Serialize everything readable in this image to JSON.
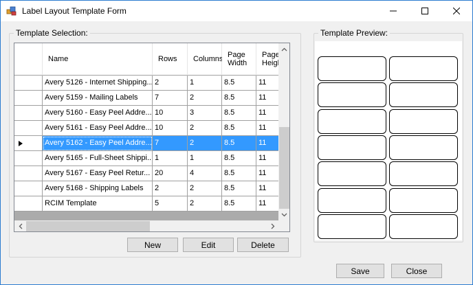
{
  "window": {
    "title": "Label Layout Template Form"
  },
  "template_selection": {
    "label": "Template Selection:",
    "columns": [
      "Name",
      "Rows",
      "Columns",
      "Page\nWidth",
      "Page\nHeigh"
    ],
    "rows": [
      {
        "name": "Avery 5126 - Internet Shipping...",
        "rows": "2",
        "columns": "1",
        "width": "8.5",
        "height": "11"
      },
      {
        "name": "Avery 5159 - Mailing Labels",
        "rows": "7",
        "columns": "2",
        "width": "8.5",
        "height": "11"
      },
      {
        "name": "Avery 5160 - Easy Peel Addre...",
        "rows": "10",
        "columns": "3",
        "width": "8.5",
        "height": "11"
      },
      {
        "name": "Avery 5161 - Easy Peel Addre...",
        "rows": "10",
        "columns": "2",
        "width": "8.5",
        "height": "11"
      },
      {
        "name": "Avery 5162 - Easy Peel Addre...",
        "rows": "7",
        "columns": "2",
        "width": "8.5",
        "height": "11"
      },
      {
        "name": "Avery 5165 - Full-Sheet Shippi...",
        "rows": "1",
        "columns": "1",
        "width": "8.5",
        "height": "11"
      },
      {
        "name": "Avery 5167 - Easy Peel Retur...",
        "rows": "20",
        "columns": "4",
        "width": "8.5",
        "height": "11"
      },
      {
        "name": "Avery 5168 - Shipping Labels",
        "rows": "2",
        "columns": "2",
        "width": "8.5",
        "height": "11"
      },
      {
        "name": "RCIM Template",
        "rows": "5",
        "columns": "2",
        "width": "8.5",
        "height": "11"
      }
    ],
    "selected_row_index": 4,
    "buttons": {
      "new": "New",
      "edit": "Edit",
      "delete": "Delete"
    }
  },
  "template_preview": {
    "label": "Template Preview:",
    "label_rows": 7,
    "label_columns": 2
  },
  "footer": {
    "save": "Save",
    "close": "Close"
  },
  "colors": {
    "selection": "#3399ff",
    "window_border": "#2b7bd0"
  }
}
